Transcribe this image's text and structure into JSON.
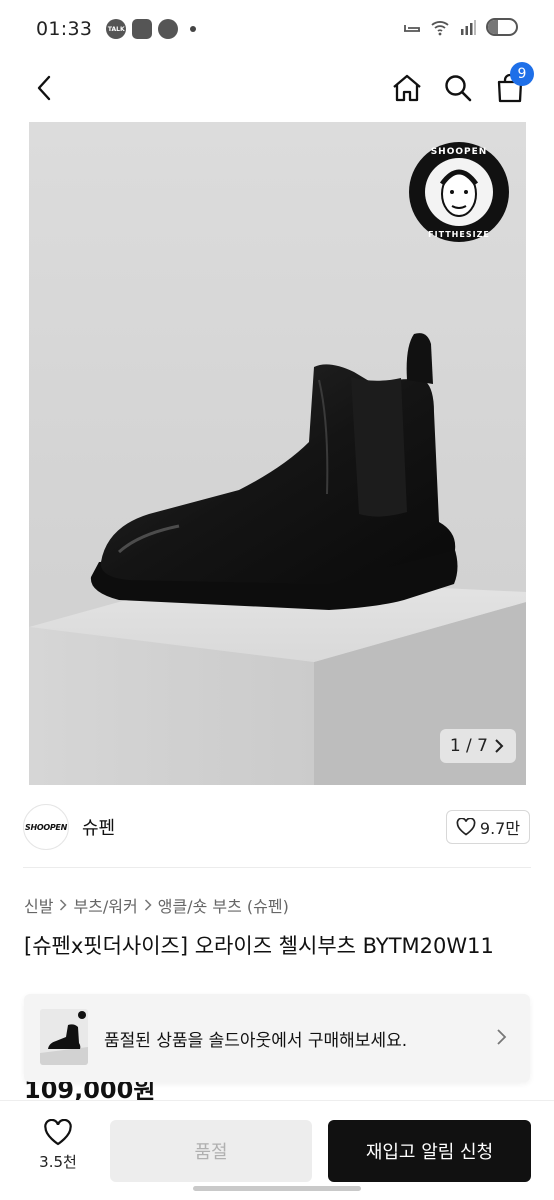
{
  "status_bar": {
    "time": "01:33",
    "apps": [
      "TALK",
      "",
      ""
    ],
    "battery_level": 0.35
  },
  "nav": {
    "cart_count": "9",
    "icons": [
      "back-icon",
      "home-icon",
      "search-icon",
      "shopping-bag-icon"
    ]
  },
  "hero": {
    "counter": "1 / 7"
  },
  "brand": {
    "logo_text": "SHOOPEN",
    "name": "슈펜",
    "likes": "9.7만"
  },
  "breadcrumb": [
    "신발",
    "부츠/워커",
    "앵클/숏 부츠 (슈펜)"
  ],
  "product": {
    "title": "[슈펜x핏더사이즈] 오라이즈 첼시부츠 BYTM20W11",
    "price": "109,000원"
  },
  "soldout_banner": {
    "text": "품절된 상품을 솔드아웃에서 구매해보세요."
  },
  "bottom_bar": {
    "like_count": "3.5천",
    "soldout_label": "품절",
    "restock_label": "재입고 알림 신청"
  },
  "colors": {
    "badge": "#1e6fe8",
    "primary_button": "#111111",
    "disabled_button": "#ededed"
  }
}
